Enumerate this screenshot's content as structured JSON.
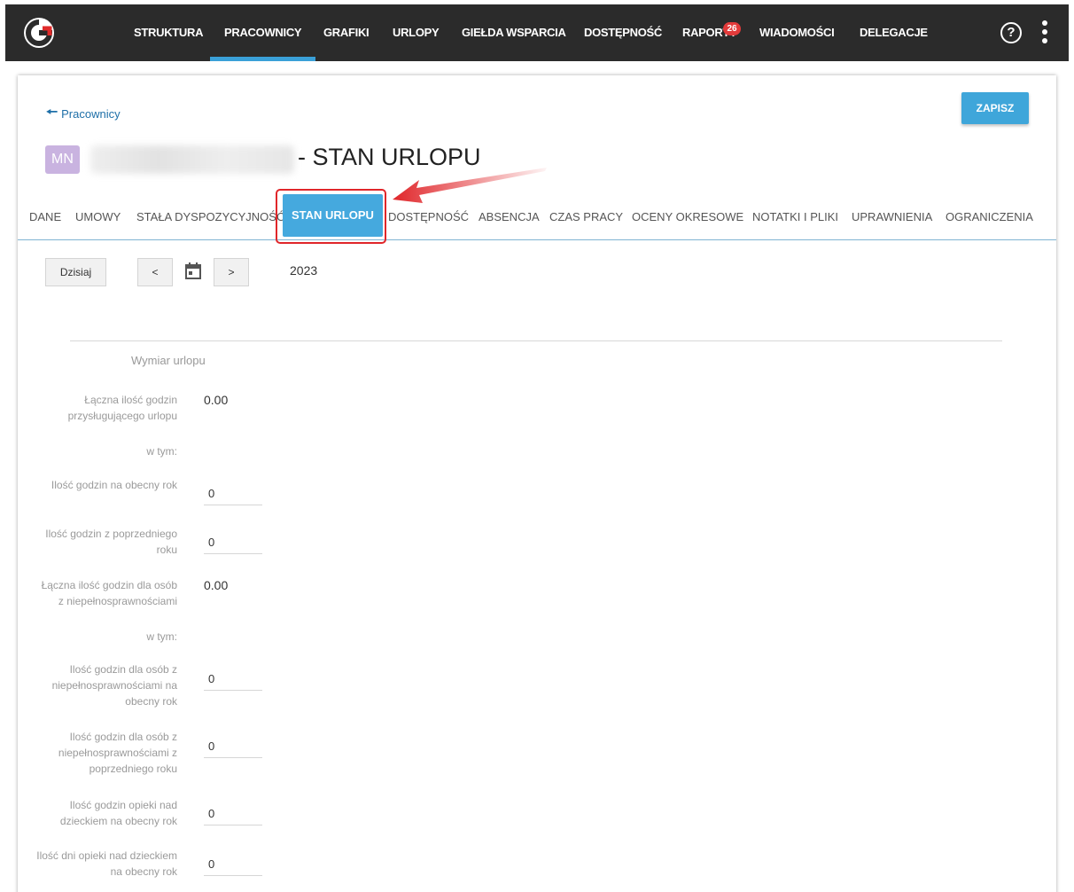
{
  "nav": {
    "items": [
      {
        "label": "STRUKTURA",
        "active": false
      },
      {
        "label": "PRACOWNICY",
        "active": true
      },
      {
        "label": "GRAFIKI",
        "active": false
      },
      {
        "label": "URLOPY",
        "active": false
      },
      {
        "label": "GIEŁDA WSPARCIA",
        "active": false
      },
      {
        "label": "DOSTĘPNOŚĆ",
        "active": false
      },
      {
        "label": "RAPORTY",
        "active": false
      },
      {
        "label": "WIADOMOŚCI",
        "active": false
      },
      {
        "label": "DELEGACJE",
        "active": false
      }
    ],
    "badge": "26",
    "help": "?"
  },
  "page": {
    "back_label": "Pracownicy",
    "save_label": "ZAPISZ",
    "avatar_initials": "MN",
    "title": "- STAN URLOPU"
  },
  "tabs": [
    {
      "label": "DANE"
    },
    {
      "label": "UMOWY"
    },
    {
      "label": "STAŁA DYSPOZYCYJNOŚĆ"
    },
    {
      "label": "STAN URLOPU",
      "active": true
    },
    {
      "label": "DOSTĘPNOŚĆ"
    },
    {
      "label": "ABSENCJA"
    },
    {
      "label": "CZAS PRACY"
    },
    {
      "label": "OCENY OKRESOWE"
    },
    {
      "label": "NOTATKI I PLIKI"
    },
    {
      "label": "UPRAWNIENIA"
    },
    {
      "label": "OGRANICZENIA"
    }
  ],
  "toolbar": {
    "today_label": "Dzisiaj",
    "prev_label": "<",
    "next_label": ">",
    "year": "2023"
  },
  "form": {
    "section_title": "Wymiar urlopu",
    "total_hours_label": "Łączna ilość godzin przysługującego urlopu",
    "total_hours_value": "0.00",
    "including_1": "w tym:",
    "current_year_label": "Ilość godzin na obecny rok",
    "current_year_value": "0",
    "previous_year_label": "Ilość godzin z poprzedniego roku",
    "previous_year_value": "0",
    "disabled_total_label": "Łączna ilość godzin dla osób z niepełnosprawnościami",
    "disabled_total_value": "0.00",
    "including_2": "w tym:",
    "disabled_current_label": "Ilość godzin dla osób z niepełnosprawnościami na obecny rok",
    "disabled_current_value": "0",
    "disabled_previous_label": "Ilość godzin dla osób z niepełnosprawnościami z poprzedniego roku",
    "disabled_previous_value": "0",
    "childcare_hours_label": "Ilość godzin opieki nad dzieckiem na obecny rok",
    "childcare_hours_value": "0",
    "childcare_days_label": "Ilość dni opieki nad dzieckiem na obecny rok",
    "childcare_days_value": "0"
  },
  "colors": {
    "topbar": "#2b2b2b",
    "accent": "#3fa6da",
    "badge": "#e23b3b",
    "annotation": "#e0262a"
  }
}
